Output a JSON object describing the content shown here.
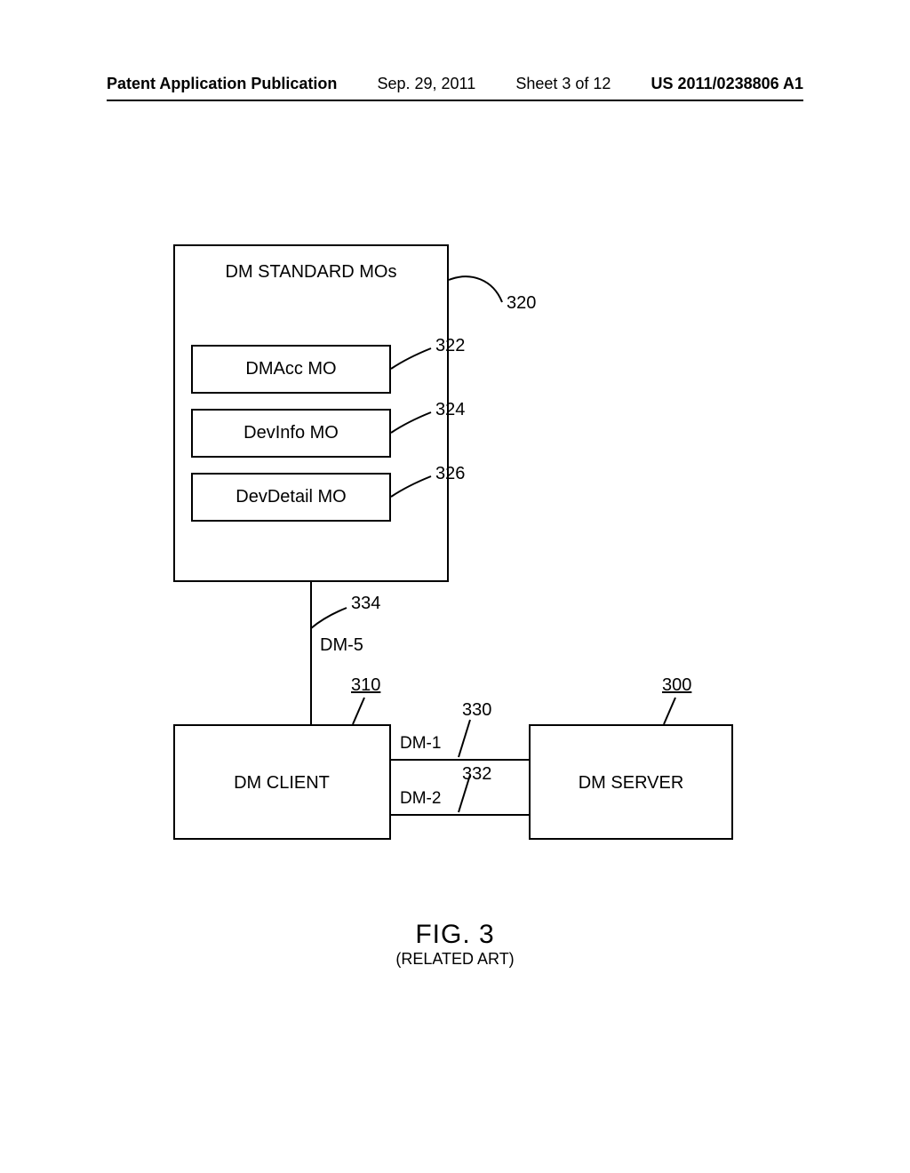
{
  "header": {
    "pub_title": "Patent Application Publication",
    "date": "Sep. 29, 2011",
    "sheet": "Sheet 3 of 12",
    "docnum": "US 2011/0238806 A1"
  },
  "mos_box": {
    "title": "DM STANDARD MOs",
    "ref": "320",
    "items": [
      {
        "label": "DMAcc MO",
        "ref": "322"
      },
      {
        "label": "DevInfo MO",
        "ref": "324"
      },
      {
        "label": "DevDetail MO",
        "ref": "326"
      }
    ]
  },
  "dm5": {
    "label": "DM-5",
    "ref": "334"
  },
  "dm_client": {
    "label": "DM CLIENT",
    "ref": "310"
  },
  "dm_server": {
    "label": "DM SERVER",
    "ref": "300"
  },
  "dm1": {
    "label": "DM-1",
    "ref": "330"
  },
  "dm2": {
    "label": "DM-2",
    "ref": "332"
  },
  "figure": {
    "title": "FIG. 3",
    "subtitle": "(RELATED ART)"
  }
}
